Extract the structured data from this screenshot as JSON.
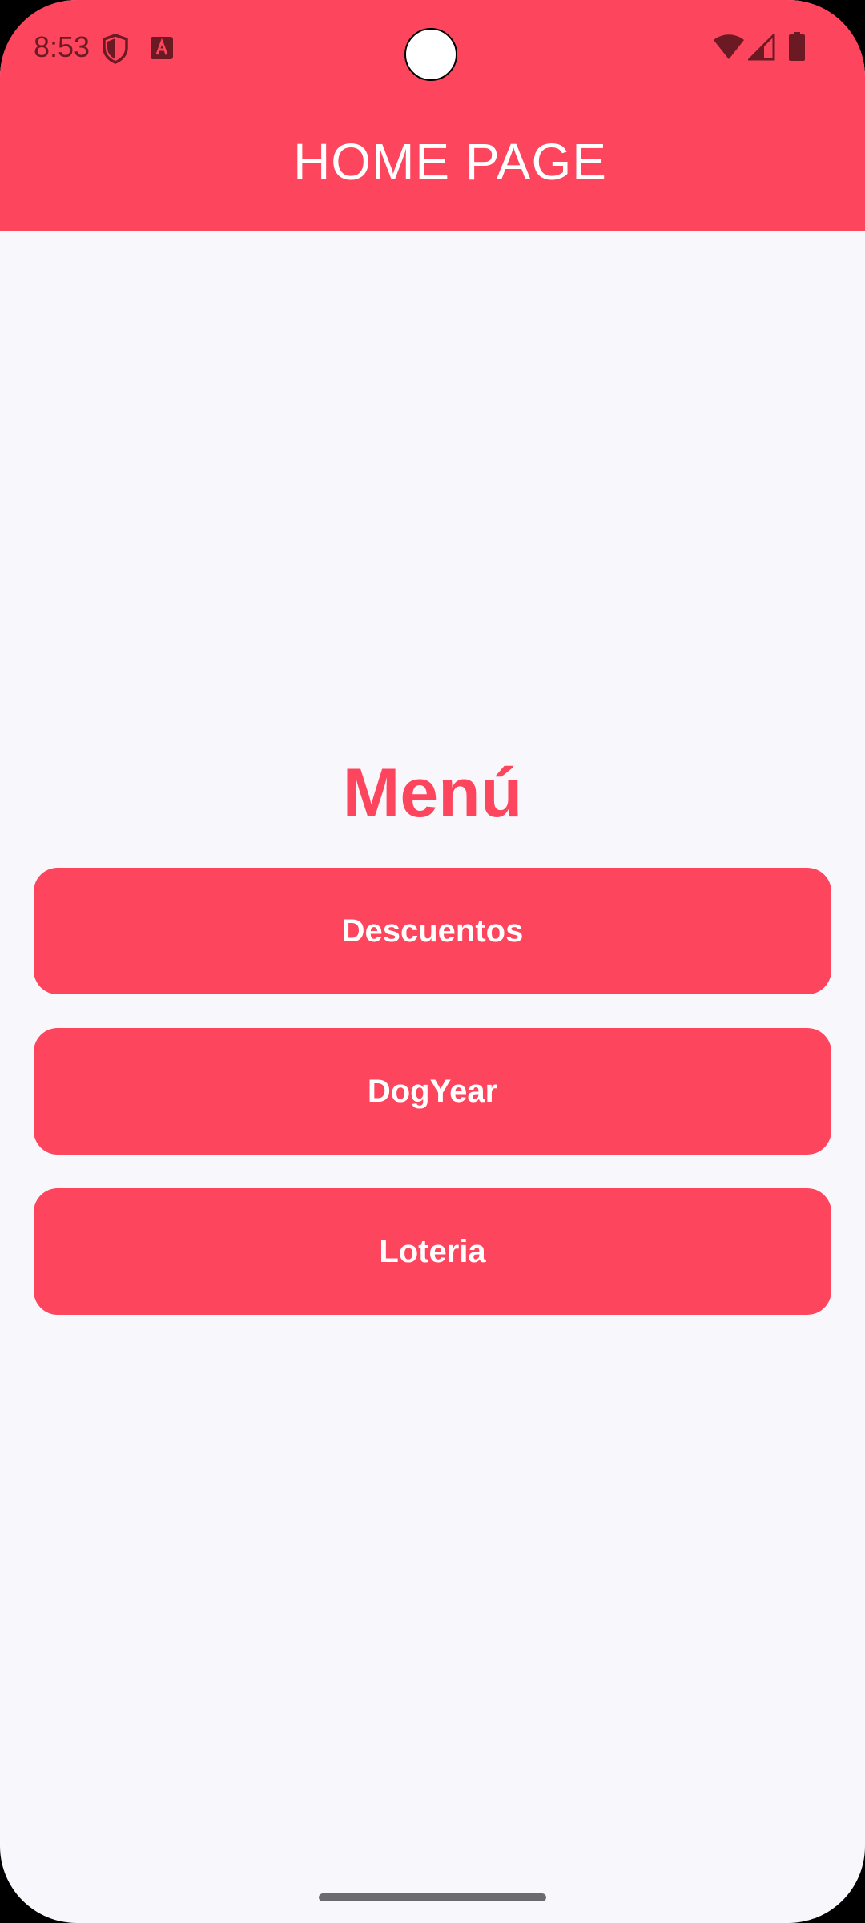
{
  "status_bar": {
    "time": "8:53",
    "icons": [
      "shield-icon",
      "app-notification-icon",
      "wifi-icon",
      "signal-icon",
      "battery-icon"
    ],
    "icon_color": "#6b1a24"
  },
  "header": {
    "title": "HOME PAGE",
    "background_color": "#fd465d"
  },
  "main": {
    "heading": "Menú",
    "buttons": [
      {
        "label": "Descuentos"
      },
      {
        "label": "DogYear"
      },
      {
        "label": "Loteria"
      }
    ],
    "accent_color": "#fd465d",
    "background_color": "#f8f7fc"
  }
}
